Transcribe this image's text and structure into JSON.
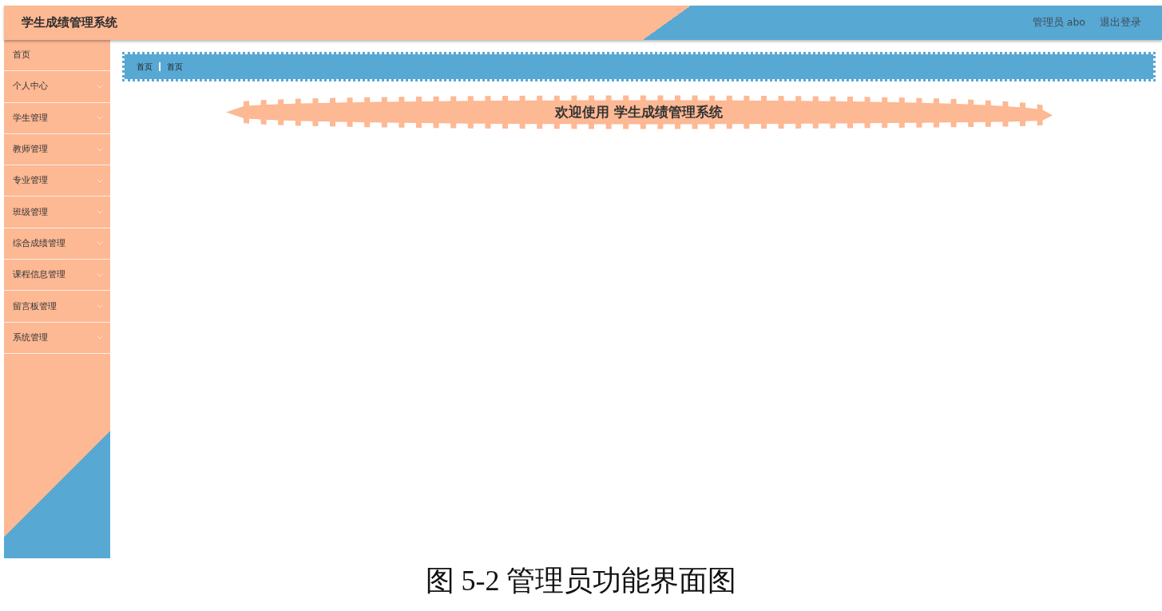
{
  "header": {
    "title": "学生成绩管理系统",
    "user": "管理员 abo",
    "logout": "退出登录"
  },
  "sidebar": {
    "items": [
      {
        "label": "首页",
        "kind": "link"
      },
      {
        "label": "个人中心",
        "kind": "submenu"
      },
      {
        "label": "学生管理",
        "kind": "submenu"
      },
      {
        "label": "教师管理",
        "kind": "submenu"
      },
      {
        "label": "专业管理",
        "kind": "submenu"
      },
      {
        "label": "班级管理",
        "kind": "submenu"
      },
      {
        "label": "综合成绩管理",
        "kind": "submenu"
      },
      {
        "label": "课程信息管理",
        "kind": "submenu"
      },
      {
        "label": "留言板管理",
        "kind": "submenu"
      },
      {
        "label": "系统管理",
        "kind": "submenu"
      }
    ]
  },
  "breadcrumb": {
    "items": [
      "首页",
      "首页"
    ]
  },
  "welcome_banner": {
    "text": "欢迎使用 学生成绩管理系统"
  },
  "caption": "图 5-2 管理员功能界面图"
}
